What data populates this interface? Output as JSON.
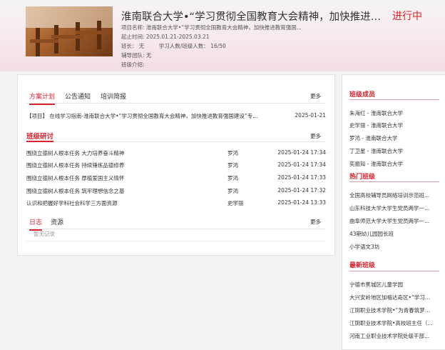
{
  "header": {
    "title": "淮南联合大学•“学习贯彻全国教育大会精神，加快推进教育强国建设”专题网络培训",
    "status": "进行中",
    "project_name_label": "项目名称:",
    "project_name": "淮南联合大学•“学习贯彻全国教育大会精神，加快推进教育强国...",
    "date_label": "起止时间:",
    "date_range": "2025.01.21-2025.03.21",
    "leader_label": "班长：",
    "leader": "无",
    "count_label": "学习人数/班级人数：",
    "count": "16/50",
    "tutor_label": "辅导团队:",
    "tutor": "无",
    "intro_label": "班级介绍:"
  },
  "plan_tabs": [
    {
      "label": "方案计划"
    },
    {
      "label": "公告通知"
    },
    {
      "label": "培训简报"
    }
  ],
  "more_label": "更多",
  "plan_row": {
    "title": "【项目】 在线学习指南-淮南联合大学•“学习贯彻全国教育大会精神，加快推进教育强国建设”专...",
    "date": "2025-01-21"
  },
  "discussion": {
    "title": "班级研讨",
    "rows": [
      {
        "title": "围绕立德树人根本任务 大力培养奋斗精神",
        "author": "罗鸿",
        "time": "2025-01-24 17:34"
      },
      {
        "title": "围绕立德树人根本任务 持续锤炼品德修养",
        "author": "罗鸿",
        "time": "2025-01-24 17:34"
      },
      {
        "title": "围绕立德树人根本任务 厚植爱国主义情怀",
        "author": "罗鸿",
        "time": "2025-01-24 17:33"
      },
      {
        "title": "围绕立德树人根本任务 筑牢理想信念之基",
        "author": "罗鸿",
        "time": "2025-01-24 17:32"
      },
      {
        "title": "认识和把握好学科社会科学三方面资源",
        "author": "史学丽",
        "time": "2025-01-24 13:33"
      }
    ]
  },
  "log_tabs": [
    {
      "label": "日志"
    },
    {
      "label": "资源"
    }
  ],
  "empty_text": "暂无记录",
  "sidebar": {
    "members_title": "班级成员",
    "members": [
      "朱海红 - 淮南联合大学",
      "史学丽 - 淮南联合大学",
      "罗鸿 - 淮南联合大学",
      "丁卫星 - 淮南联合大学",
      "奕振知 - 淮南联合大学"
    ],
    "hot_title": "热门班级",
    "hot": [
      "全国高校辅导员网络培训示范班...",
      "山东科技大学大学生党员两学一...",
      "曲阜师范大学大学生党员两学一...",
      "43期幼儿园园长班",
      "小学语文3坊"
    ],
    "new_title": "最新班级",
    "new": [
      "宁德市蕉城区儿童学园",
      "大兴安岭地区加格达奇区•“学习...",
      "江阴职业技术学院•“为青春筑梦...",
      "江阴职业技术学院•高校班主任（...",
      "河南工业职业技术学院处级干部..."
    ]
  },
  "colors": {
    "accent": "#d9232e"
  }
}
